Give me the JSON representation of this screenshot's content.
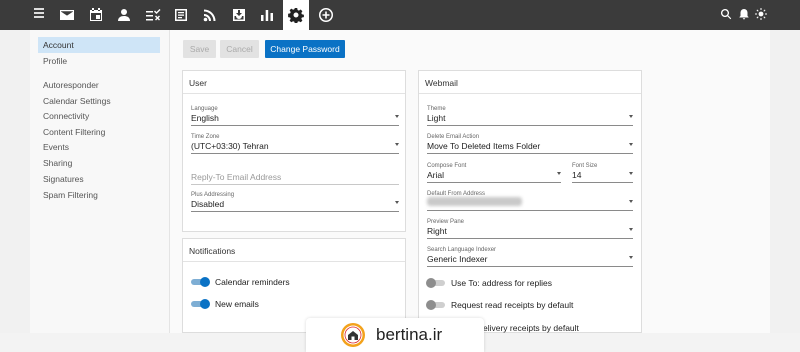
{
  "topbar": {
    "nav_icons": [
      "menu-icon",
      "mail-icon",
      "calendar-icon",
      "contacts-icon",
      "tasks-icon",
      "notes-icon",
      "rss-icon",
      "archive-icon",
      "reports-icon",
      "settings-icon",
      "add-icon"
    ],
    "active": "settings-icon",
    "right_icons": [
      "search-icon",
      "bell-icon",
      "brightness-icon"
    ]
  },
  "sidebar": {
    "items": [
      {
        "label": "Account",
        "active": true
      },
      {
        "label": "Profile",
        "active": false
      },
      {
        "label": "Autoresponder",
        "active": false
      },
      {
        "label": "Calendar Settings",
        "active": false
      },
      {
        "label": "Connectivity",
        "active": false
      },
      {
        "label": "Content Filtering",
        "active": false
      },
      {
        "label": "Events",
        "active": false
      },
      {
        "label": "Sharing",
        "active": false
      },
      {
        "label": "Signatures",
        "active": false
      },
      {
        "label": "Spam Filtering",
        "active": false
      }
    ]
  },
  "toolbar": {
    "save_label": "Save",
    "cancel_label": "Cancel",
    "change_password_label": "Change Password"
  },
  "user_card": {
    "title": "User",
    "language": {
      "label": "Language",
      "value": "English"
    },
    "timezone": {
      "label": "Time Zone",
      "value": "(UTC+03:30) Tehran"
    },
    "reply_to": {
      "placeholder": "Reply-To Email Address"
    },
    "plus_addressing": {
      "label": "Plus Addressing",
      "value": "Disabled"
    }
  },
  "notifications_card": {
    "title": "Notifications",
    "calendar_reminders": {
      "label": "Calendar reminders",
      "on": true
    },
    "new_emails": {
      "label": "New emails",
      "on": true
    }
  },
  "webmail_card": {
    "title": "Webmail",
    "theme": {
      "label": "Theme",
      "value": "Light"
    },
    "delete_action": {
      "label": "Delete Email Action",
      "value": "Move To Deleted Items Folder"
    },
    "compose_font": {
      "label": "Compose Font",
      "value": "Arial"
    },
    "font_size": {
      "label": "Font Size",
      "value": "14"
    },
    "default_from": {
      "label": "Default From Address"
    },
    "preview_pane": {
      "label": "Preview Pane",
      "value": "Right"
    },
    "search_indexer": {
      "label": "Search Language Indexer",
      "value": "Generic Indexer"
    },
    "use_to": {
      "label": "Use To: address for replies",
      "on": false
    },
    "read_receipts": {
      "label": "Request read receipts by default",
      "on": false
    },
    "delivery_receipts": {
      "label": "elivery receipts by default",
      "on": false
    }
  },
  "watermark": {
    "text": "bertina.ir"
  },
  "colors": {
    "topbar": "#3b3b3b",
    "accent": "#0a72c5",
    "sidebar_active": "#cfe5f7"
  }
}
